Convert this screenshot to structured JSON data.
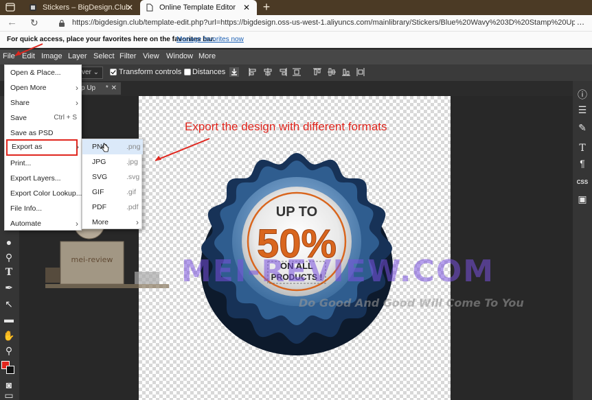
{
  "browser": {
    "tabs": [
      {
        "label": "Stickers – BigDesign.Club",
        "close": "✕"
      },
      {
        "label": "Online Template Editor",
        "close": "✕"
      }
    ],
    "new_tab": "+",
    "url": "https://bigdesign.club/template-edit.php?url=https://bigdesign.oss-us-west-1.aliyuncs.com/mainlibrary/Stickers/Blue%20Wavy%203D%20Stamp%20Up%20To%207...",
    "more": "...",
    "favorites_text": "For quick access, place your favorites here on the favorites bar.",
    "favorites_link": "Manage favorites now"
  },
  "menubar": {
    "items": [
      "File",
      "Edit",
      "Image",
      "Layer",
      "Select",
      "Filter",
      "View",
      "Window",
      "More"
    ]
  },
  "optbar": {
    "layer_select": "ver",
    "transform_controls": "Transform controls",
    "distances": "Distances"
  },
  "document_tab": {
    "label": "p Up",
    "modified": "*",
    "close": "✕"
  },
  "file_menu": {
    "items": [
      {
        "label": "Open & Place...",
        "shortcut": "",
        "arrow": ""
      },
      {
        "label": "Open More",
        "shortcut": "",
        "arrow": "›"
      },
      {
        "label": "Share",
        "shortcut": "",
        "arrow": "›"
      },
      {
        "label": "Save",
        "shortcut": "Ctrl + S",
        "arrow": ""
      },
      {
        "label": "Save as PSD",
        "shortcut": "",
        "arrow": ""
      },
      {
        "label": "Export as",
        "shortcut": "",
        "arrow": "›"
      },
      {
        "label": "Print...",
        "shortcut": "",
        "arrow": ""
      },
      {
        "label": "Export Layers...",
        "shortcut": "",
        "arrow": ""
      },
      {
        "label": "Export Color Lookup...",
        "shortcut": "",
        "arrow": ""
      },
      {
        "label": "File Info...",
        "shortcut": "",
        "arrow": ""
      },
      {
        "label": "Automate",
        "shortcut": "",
        "arrow": "›"
      }
    ]
  },
  "export_submenu": {
    "items": [
      {
        "label": "PNG",
        "ext": ".png"
      },
      {
        "label": "JPG",
        "ext": ".jpg"
      },
      {
        "label": "SVG",
        "ext": ".svg"
      },
      {
        "label": "GIF",
        "ext": ".gif"
      },
      {
        "label": "PDF",
        "ext": ".pdf"
      },
      {
        "label": "More",
        "ext": ""
      }
    ]
  },
  "annotation": "Export the design with different formats",
  "badge": {
    "line1": "UP TO",
    "line2": "50%",
    "line3": "ON ALL",
    "line4": "PRODUCTS !"
  },
  "watermark": {
    "main": "MEI-REVIEW.COM",
    "sub": "Do Good And Good Will Come To You",
    "mascot_label": "mei-review"
  },
  "colors": {
    "accent_red": "#e0261e",
    "badge_blue": "#5c8cc0",
    "badge_orange": "#d9661e",
    "menu_highlight": "#dbe9f9"
  }
}
